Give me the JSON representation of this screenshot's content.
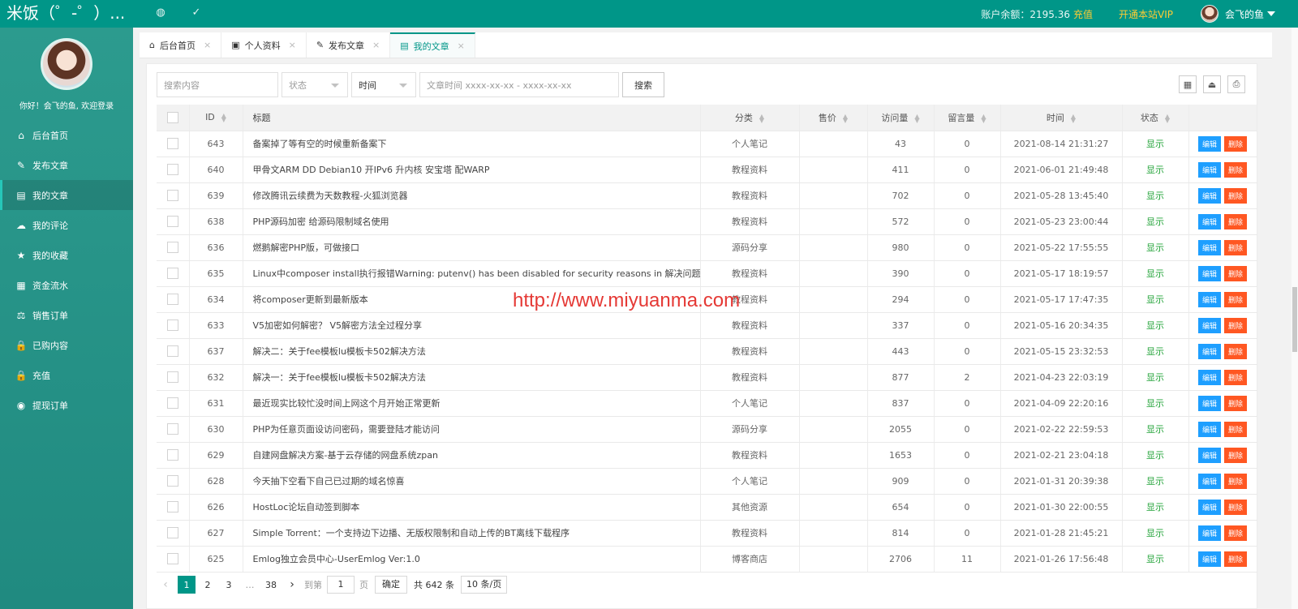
{
  "topbar": {
    "logo": "米饭（゜-゜）...",
    "globe_icon": "globe-icon",
    "check_icon": "check-icon",
    "balance": "账户余额：2195.36",
    "recharge": "充值",
    "vip": "开通本站VIP",
    "username": "会飞的鱼"
  },
  "sidebar": {
    "welcome": "你好！会飞的鱼, 欢迎登录",
    "items": [
      {
        "label": "后台首页",
        "icon": "⌂",
        "active": false
      },
      {
        "label": "发布文章",
        "icon": "✎",
        "active": false
      },
      {
        "label": "我的文章",
        "icon": "▤",
        "active": true
      },
      {
        "label": "我的评论",
        "icon": "☁",
        "active": false
      },
      {
        "label": "我的收藏",
        "icon": "★",
        "active": false
      },
      {
        "label": "资金流水",
        "icon": "▦",
        "active": false
      },
      {
        "label": "销售订单",
        "icon": "⚖",
        "active": false
      },
      {
        "label": "已购内容",
        "icon": "🔒",
        "active": false
      },
      {
        "label": "充值",
        "icon": "🔒",
        "active": false
      },
      {
        "label": "提现订单",
        "icon": "◉",
        "active": false
      }
    ]
  },
  "tabs": [
    {
      "label": "后台首页",
      "icon": "⌂",
      "active": false
    },
    {
      "label": "个人资料",
      "icon": "▣",
      "active": false
    },
    {
      "label": "发布文章",
      "icon": "✎",
      "active": false
    },
    {
      "label": "我的文章",
      "icon": "▤",
      "active": true
    }
  ],
  "toolbar": {
    "search_placeholder": "搜索内容",
    "status_placeholder": "状态",
    "time_label": "时间",
    "date_placeholder": "文章时间 xxxx-xx-xx - xxxx-xx-xx",
    "search_button": "搜索"
  },
  "table": {
    "headers": [
      "ID",
      "标题",
      "分类",
      "售价",
      "访问量",
      "留言量",
      "时间",
      "状态"
    ],
    "edit_label": "编辑",
    "delete_label": "删除",
    "rows": [
      {
        "id": "643",
        "title": "备案掉了等有空的时候重新备案下",
        "category": "个人笔记",
        "price": "",
        "views": "43",
        "comments": "0",
        "time": "2021-08-14 21:31:27",
        "status": "显示"
      },
      {
        "id": "640",
        "title": "甲骨文ARM DD Debian10 开IPv6 升内核 安宝塔 配WARP",
        "category": "教程资料",
        "price": "",
        "views": "411",
        "comments": "0",
        "time": "2021-06-01 21:49:48",
        "status": "显示"
      },
      {
        "id": "639",
        "title": "修改腾讯云续费为天数教程-火狐浏览器",
        "category": "教程资料",
        "price": "",
        "views": "702",
        "comments": "0",
        "time": "2021-05-28 13:45:40",
        "status": "显示"
      },
      {
        "id": "638",
        "title": "PHP源码加密 给源码限制域名使用",
        "category": "教程资料",
        "price": "",
        "views": "572",
        "comments": "0",
        "time": "2021-05-23 23:00:44",
        "status": "显示"
      },
      {
        "id": "636",
        "title": "燃鹅解密PHP版，可做接口",
        "category": "源码分享",
        "price": "",
        "views": "980",
        "comments": "0",
        "time": "2021-05-22 17:55:55",
        "status": "显示"
      },
      {
        "id": "635",
        "title": "Linux中composer install执行报错Warning: putenv() has been disabled for security reasons in 解决问题",
        "category": "教程资料",
        "price": "",
        "views": "390",
        "comments": "0",
        "time": "2021-05-17 18:19:57",
        "status": "显示"
      },
      {
        "id": "634",
        "title": "将composer更新到最新版本",
        "category": "教程资料",
        "price": "",
        "views": "294",
        "comments": "0",
        "time": "2021-05-17 17:47:35",
        "status": "显示"
      },
      {
        "id": "633",
        "title": "V5加密如何解密？ V5解密方法全过程分享",
        "category": "教程资料",
        "price": "",
        "views": "337",
        "comments": "0",
        "time": "2021-05-16 20:34:35",
        "status": "显示"
      },
      {
        "id": "637",
        "title": "解决二：关于fee模板lu模板卡502解决方法",
        "category": "教程资料",
        "price": "",
        "views": "443",
        "comments": "0",
        "time": "2021-05-15 23:32:53",
        "status": "显示"
      },
      {
        "id": "632",
        "title": "解决一：关于fee模板lu模板卡502解决方法",
        "category": "教程资料",
        "price": "",
        "views": "877",
        "comments": "2",
        "time": "2021-04-23 22:03:19",
        "status": "显示"
      },
      {
        "id": "631",
        "title": "最近现实比较忙没时间上网这个月开始正常更新",
        "category": "个人笔记",
        "price": "",
        "views": "837",
        "comments": "0",
        "time": "2021-04-09 22:20:16",
        "status": "显示"
      },
      {
        "id": "630",
        "title": "PHP为任意页面设访问密码，需要登陆才能访问",
        "category": "源码分享",
        "price": "",
        "views": "2055",
        "comments": "0",
        "time": "2021-02-22 22:59:53",
        "status": "显示"
      },
      {
        "id": "629",
        "title": "自建网盘解决方案-基于云存储的网盘系统zpan",
        "category": "教程资料",
        "price": "",
        "views": "1653",
        "comments": "0",
        "time": "2021-02-21 23:04:18",
        "status": "显示"
      },
      {
        "id": "628",
        "title": "今天抽下空看下自己已过期的域名惊喜",
        "category": "个人笔记",
        "price": "",
        "views": "909",
        "comments": "0",
        "time": "2021-01-31 20:39:38",
        "status": "显示"
      },
      {
        "id": "626",
        "title": "HostLoc论坛自动签到脚本",
        "category": "其他资源",
        "price": "",
        "views": "654",
        "comments": "0",
        "time": "2021-01-30 22:00:55",
        "status": "显示"
      },
      {
        "id": "627",
        "title": "Simple Torrent：一个支持边下边播、无版权限制和自动上传的BT离线下载程序",
        "category": "教程资料",
        "price": "",
        "views": "814",
        "comments": "0",
        "time": "2021-01-28 21:45:21",
        "status": "显示"
      },
      {
        "id": "625",
        "title": "Emlog独立会员中心-UserEmlog Ver:1.0",
        "category": "博客商店",
        "price": "",
        "views": "2706",
        "comments": "11",
        "time": "2021-01-26 17:56:48",
        "status": "显示"
      }
    ]
  },
  "pagination": {
    "prev": "‹",
    "pages": [
      "1",
      "2",
      "3"
    ],
    "ellipsis": "…",
    "last": "38",
    "next": "›",
    "goto_label": "到第",
    "goto_value": "1",
    "page_unit": "页",
    "confirm": "确定",
    "total": "共 642 条",
    "page_size": "10 条/页"
  },
  "watermark": "http://www.miyuanma.com",
  "colors": {
    "primary": "#009688",
    "edit": "#1e9fff",
    "delete": "#ff5722",
    "status": "#22a338",
    "vip": "#ffcc33"
  }
}
